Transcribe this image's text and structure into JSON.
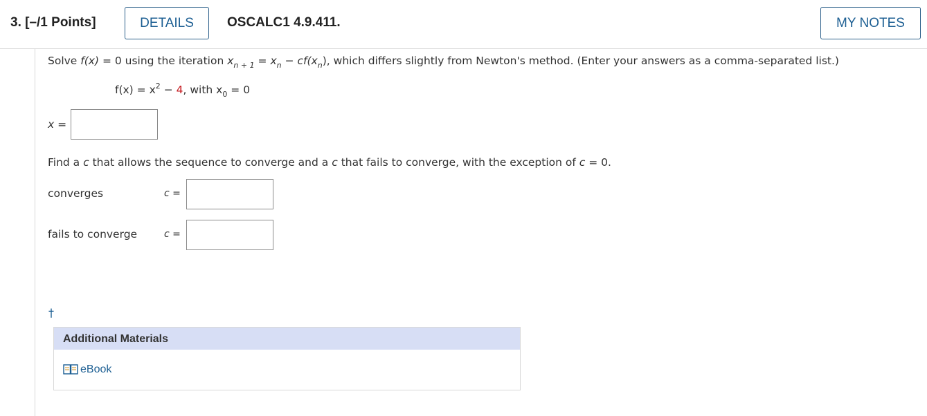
{
  "header": {
    "question_number": "3. [–/1 Points]",
    "details_label": "DETAILS",
    "code": "OSCALC1 4.9.411.",
    "notes_label": "MY NOTES"
  },
  "problem": {
    "solve": "Solve",
    "fx": "f(x)",
    "eq0": "= 0 using the iteration",
    "x": "x",
    "n1": "n + 1",
    "eq": "=",
    "n": "n",
    "minus": "−",
    "cf": "cf(x",
    "close": "),",
    "rest": "which differs slightly from Newton's method. (Enter your answers as a comma-separated list.)",
    "func_lhs": "f(x) = x",
    "func_exp": "2",
    "func_minus": "−",
    "func_const": "4",
    "func_with": ", with x",
    "func_zero": "0",
    "func_eq": "= 0",
    "x_label": "x ="
  },
  "part2": {
    "text_a": "Find a",
    "c": "c",
    "text_b": "that allows the sequence to converge and a",
    "text_c": "that fails to converge, with the exception of",
    "text_d": "= 0.",
    "converges_label": "converges",
    "fails_label": "fails to converge",
    "c_eq": "c ="
  },
  "footer": {
    "dagger": "†",
    "materials_title": "Additional Materials",
    "ebook_label": "eBook"
  },
  "colors": {
    "accent": "#1d5f93",
    "highlight": "#c4161c",
    "materials_bg": "#d7def5"
  },
  "icons": {
    "ebook": "book-icon"
  }
}
